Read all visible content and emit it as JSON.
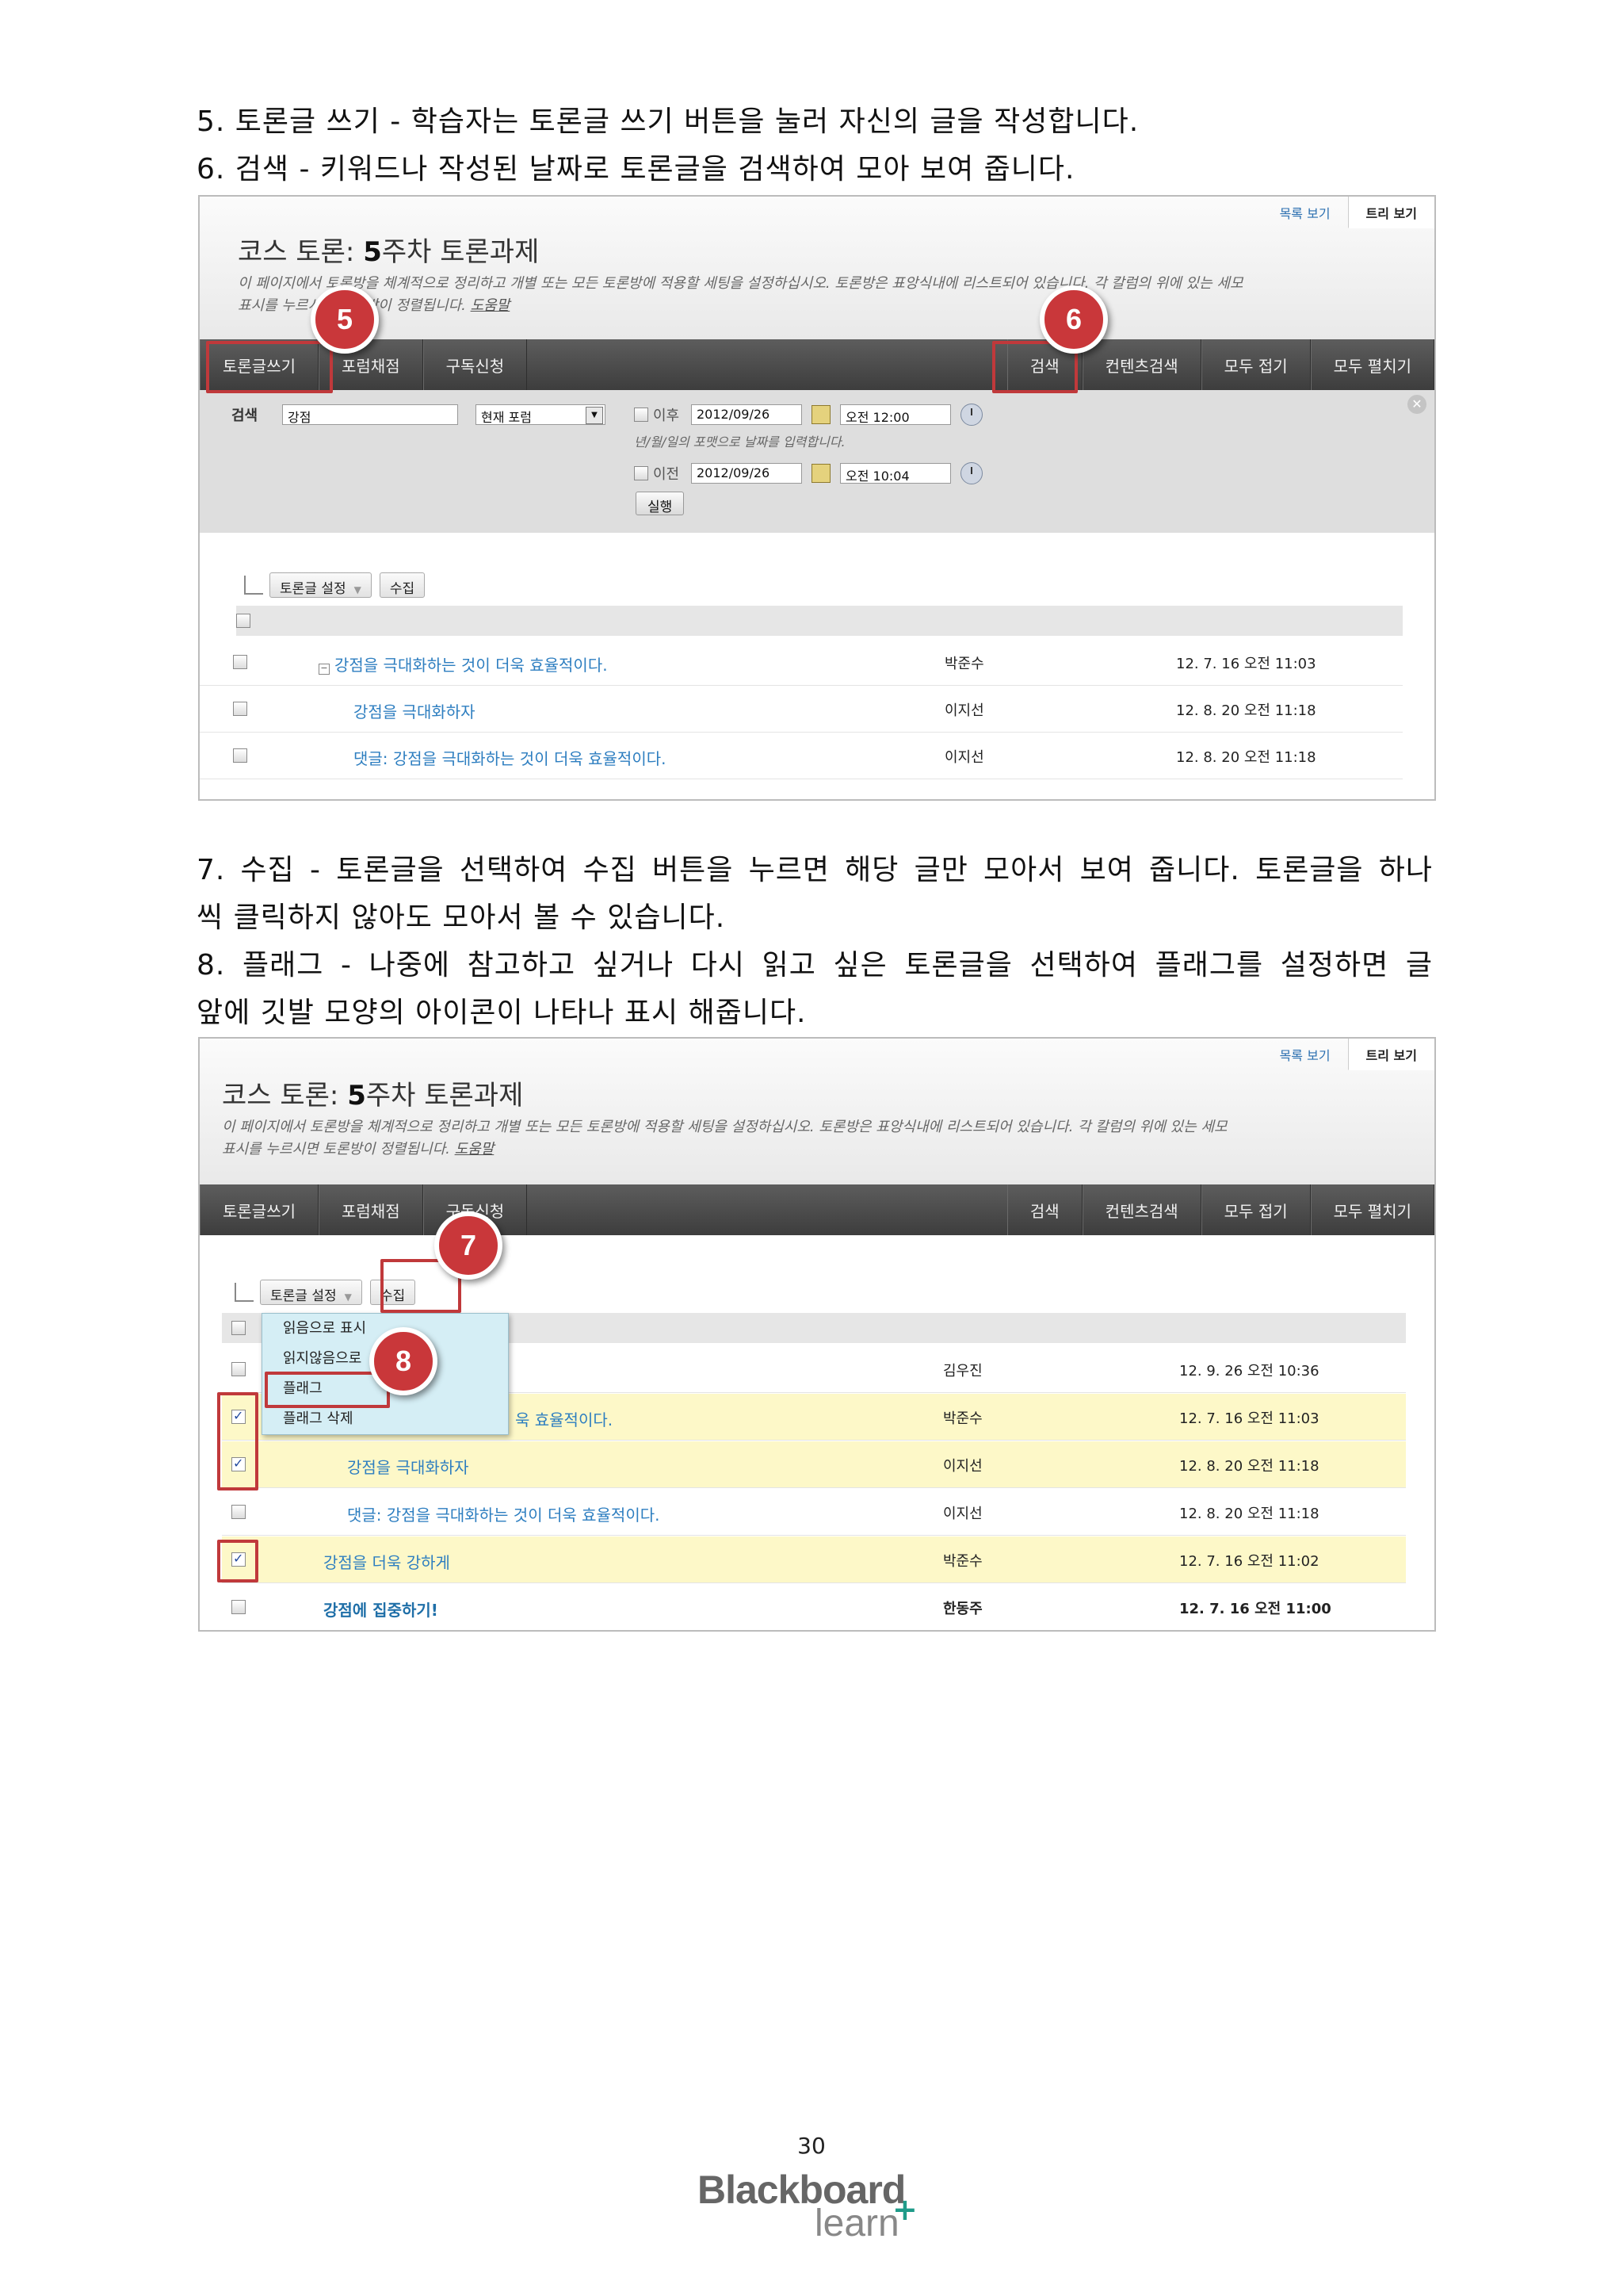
{
  "paragraphs": {
    "p5": "5. 토론글 쓰기 - 학습자는 토론글 쓰기 버튼을 눌러 자신의 글을 작성합니다.",
    "p6": "6. 검색 - 키워드나 작성된 날짜로 토론글을 검색하여 모아 보여 줍니다.",
    "p7_line1": "7. 수집 - 토론글을 선택하여 수집 버튼을 누르면 해당 글만 모아서 보여 줍니다. 토론글을 하나",
    "p7_line2": "씩 클릭하지 않아도 모아서 볼 수 있습니다.",
    "p8_line1": "8. 플래그 - 나중에 참고하고 싶거나 다시 읽고 싶은 토론글을 선택하여 플래그를 설정하면 글",
    "p8_line2": "앞에 깃발 모양의 아이콘이 나타나 표시 해줍니다."
  },
  "forum": {
    "view_list": "목록 보기",
    "view_tree": "트리 보기",
    "title_prefix": "코스 토론: ",
    "title_bold": "5",
    "title_rest": "주차 토론과제",
    "desc_line1": "이 페이지에서 토론방을 체계적으로 정리하고 개별 또는 모든 토론방에 적용할 세팅을 설정하십시오. 토론방은 표앙식내에 리스트되어 있습니다. 각 칼럼의 위에 있는 세모",
    "desc_line2": "표시를 누르시면 토론방이 정렬됩니다.",
    "help_link": "도움말",
    "toolbar_left": [
      "토론글쓰기",
      "포럼채점",
      "구독신청"
    ],
    "toolbar_right": [
      "검색",
      "컨텐츠검색",
      "모두 접기",
      "모두 펼치기"
    ]
  },
  "search": {
    "label": "검색",
    "keyword": "강점",
    "scope": "현재 포럼",
    "after_label": "이후",
    "after_date": "2012/09/26",
    "after_time": "오전 12:00",
    "hint": "년/월/일의 포맷으로 날짜를 입력합니다.",
    "before_label": "이전",
    "before_date": "2012/09/26",
    "before_time": "오전 10:04",
    "run": "실행"
  },
  "actions": {
    "settings": "토론글 설정",
    "collect": "수집"
  },
  "list1": [
    {
      "title": "강점을 극대화하는 것이 더욱 효율적이다.",
      "author": "박준수",
      "date": "12. 7. 16 오전 11:03"
    },
    {
      "title": "강점을 극대화하자",
      "author": "이지선",
      "date": "12. 8. 20 오전 11:18"
    },
    {
      "title": "댓글: 강점을 극대화하는 것이 더욱 효율적이다.",
      "author": "이지선",
      "date": "12. 8. 20 오전 11:18"
    }
  ],
  "dropdown": [
    "읽음으로 표시",
    "읽지않음으로",
    "플래그",
    "플래그 삭제"
  ],
  "list2": [
    {
      "title": "",
      "author": "김우진",
      "date": "12. 9. 26 오전 10:36"
    },
    {
      "title": "욱 효율적이다.",
      "author": "박준수",
      "date": "12. 7. 16 오전 11:03"
    },
    {
      "title": "강점을 극대화하자",
      "author": "이지선",
      "date": "12. 8. 20 오전 11:18"
    },
    {
      "title": "댓글: 강점을 극대화하는 것이 더욱 효율적이다.",
      "author": "이지선",
      "date": "12. 8. 20 오전 11:18"
    },
    {
      "title": "강점을 더욱 강하게",
      "author": "박준수",
      "date": "12. 7. 16 오전 11:02"
    },
    {
      "title": "강점에 집중하기!",
      "author": "한동주",
      "date": "12. 7. 16 오전 11:00"
    }
  ],
  "callouts": {
    "c5": "5",
    "c6": "6",
    "c7": "7",
    "c8": "8"
  },
  "footer": {
    "page_number": "30",
    "logo_main": "Blackboard",
    "logo_sub": "learn",
    "logo_plus": "+"
  },
  "colors": {
    "callout": "#c9373a",
    "highlight_row": "#fdf8c8",
    "toolbar": "#4a4a4a",
    "link": "#2d7ec0"
  }
}
